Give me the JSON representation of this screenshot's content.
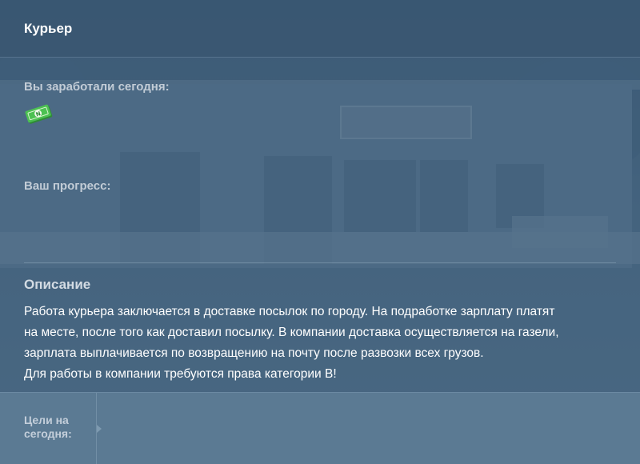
{
  "header": {
    "title": "Курьер"
  },
  "earnings": {
    "label": "Вы заработали сегодня:",
    "icon": "cash-icon"
  },
  "progress": {
    "label": "Ваш прогресс:"
  },
  "description": {
    "title": "Описание",
    "lines": [
      "Работа курьера заключается в доставке посылок по городу. На подработке зарплату платят",
      "на месте, после того как доставил посылку. В компании доставка осуществляется на газели,",
      "зарплата выплачивается по возвращению на почту после развозки всех грузов.",
      "Для работы в компании требуются права категории В!"
    ]
  },
  "goals": {
    "label": "Цели на сегодня:"
  },
  "colors": {
    "header_bg": "#395772",
    "panel_bg": "#4a6781",
    "footer_bg": "#5b7a93",
    "cash_green": "#3fae45"
  }
}
